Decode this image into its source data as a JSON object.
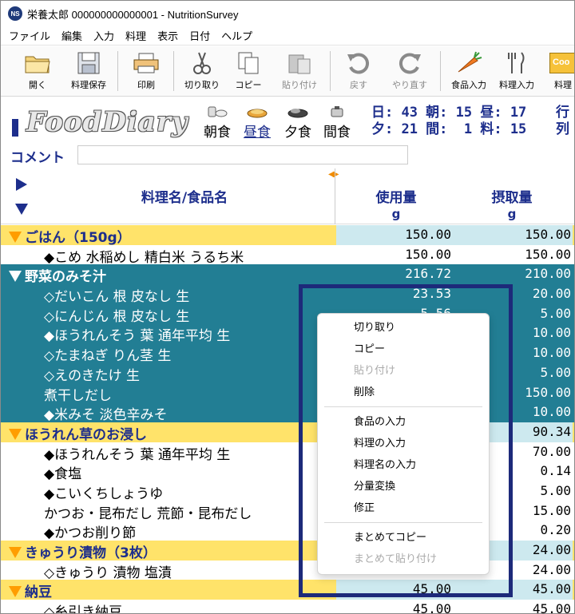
{
  "window": {
    "app_icon_text": "NS",
    "title": "栄養太郎 000000000000001 - NutritionSurvey"
  },
  "menu": [
    "ファイル",
    "編集",
    "入力",
    "料理",
    "表示",
    "日付",
    "ヘルプ"
  ],
  "toolbar": {
    "open": "開く",
    "save": "料理保存",
    "print": "印刷",
    "cut": "切り取り",
    "copy": "コピー",
    "paste": "貼り付け",
    "undo": "戻す",
    "redo": "やり直す",
    "food_input": "食品入力",
    "dish_input": "料理入力",
    "more": "料理",
    "more_icon_text": "Coo"
  },
  "diary": {
    "logo": "FoodDiary",
    "meals": [
      "朝食",
      "昼食",
      "夕食",
      "間食"
    ],
    "active_meal": "昼食",
    "counts_line1": "日: 43 朝: 15 昼: 17",
    "counts_line2": "夕: 21 間:  1 料: 15",
    "right_line1": "行",
    "right_line2": "列"
  },
  "comment": {
    "label": "コメント",
    "value": ""
  },
  "columns": {
    "name": "料理名/食品名",
    "used": "使用量",
    "used_unit": "g",
    "intake": "摂取量",
    "intake_unit": "g"
  },
  "rows": [
    {
      "type": "dish",
      "sel": false,
      "name": "ごはん（150g）",
      "used": "150.00",
      "intake": "150.00"
    },
    {
      "type": "food",
      "sel": false,
      "name": "◆こめ 水稲めし 精白米 うるち米",
      "used": "150.00",
      "intake": "150.00"
    },
    {
      "type": "dish",
      "sel": true,
      "name": "野菜のみそ汁",
      "used": "216.72",
      "intake": "210.00"
    },
    {
      "type": "food",
      "sel": true,
      "name": "◇だいこん 根 皮なし 生",
      "used": "23.53",
      "intake": "20.00"
    },
    {
      "type": "food",
      "sel": true,
      "name": "◇にんじん 根 皮なし 生",
      "used": "5.56",
      "intake": "5.00"
    },
    {
      "type": "food",
      "sel": true,
      "name": "◆ほうれんそう 葉 通年平均 生",
      "used": "",
      "intake": "10.00"
    },
    {
      "type": "food",
      "sel": true,
      "name": "◇たまねぎ りん茎 生",
      "used": "",
      "intake": "10.00"
    },
    {
      "type": "food",
      "sel": true,
      "name": "◇えのきたけ 生",
      "used": "",
      "intake": "5.00"
    },
    {
      "type": "food",
      "sel": true,
      "name": "煮干しだし",
      "used": "",
      "intake": "150.00"
    },
    {
      "type": "food",
      "sel": true,
      "name": "◆米みそ 淡色辛みそ",
      "used": "",
      "intake": "10.00"
    },
    {
      "type": "dish",
      "sel": false,
      "name": "ほうれん草のお浸し",
      "used": "",
      "intake": "90.34"
    },
    {
      "type": "food",
      "sel": false,
      "name": "◆ほうれんそう 葉 通年平均 生",
      "used": "",
      "intake": "70.00"
    },
    {
      "type": "food",
      "sel": false,
      "name": "◆食塩",
      "used": "",
      "intake": "0.14"
    },
    {
      "type": "food",
      "sel": false,
      "name": "◆こいくちしょうゆ",
      "used": "",
      "intake": "5.00"
    },
    {
      "type": "food",
      "sel": false,
      "name": "かつお・昆布だし 荒節・昆布だし",
      "used": "",
      "intake": "15.00"
    },
    {
      "type": "food",
      "sel": false,
      "name": "◆かつお削り節",
      "used": "",
      "intake": "0.20"
    },
    {
      "type": "dish",
      "sel": false,
      "name": "きゅうり漬物（3枚）",
      "used": "",
      "intake": "24.00"
    },
    {
      "type": "food",
      "sel": false,
      "name": "◇きゅうり 漬物 塩漬",
      "used": "",
      "intake": "24.00"
    },
    {
      "type": "dish",
      "sel": false,
      "name": "納豆",
      "used": "45.00",
      "intake": "45.00"
    },
    {
      "type": "food",
      "sel": false,
      "name": "◇糸引き納豆",
      "used": "45.00",
      "intake": "45.00"
    }
  ],
  "context_menu": {
    "group1": [
      {
        "label": "切り取り",
        "disabled": false
      },
      {
        "label": "コピー",
        "disabled": false
      },
      {
        "label": "貼り付け",
        "disabled": true
      },
      {
        "label": "削除",
        "disabled": false
      }
    ],
    "group2": [
      {
        "label": "食品の入力",
        "disabled": false
      },
      {
        "label": "料理の入力",
        "disabled": false
      },
      {
        "label": "料理名の入力",
        "disabled": false
      },
      {
        "label": "分量変換",
        "disabled": false
      },
      {
        "label": "修正",
        "disabled": false
      }
    ],
    "group3": [
      {
        "label": "まとめてコピー",
        "disabled": false
      },
      {
        "label": "まとめて貼り付け",
        "disabled": true
      }
    ]
  },
  "colors": {
    "accent": "#1d2e8c",
    "selection": "#227e94",
    "dish_row": "#ffe36a",
    "dish_value_cell": "#cde9ef",
    "dish_triangle": "#ff9d00",
    "highlight_border": "#1d2a7a"
  }
}
